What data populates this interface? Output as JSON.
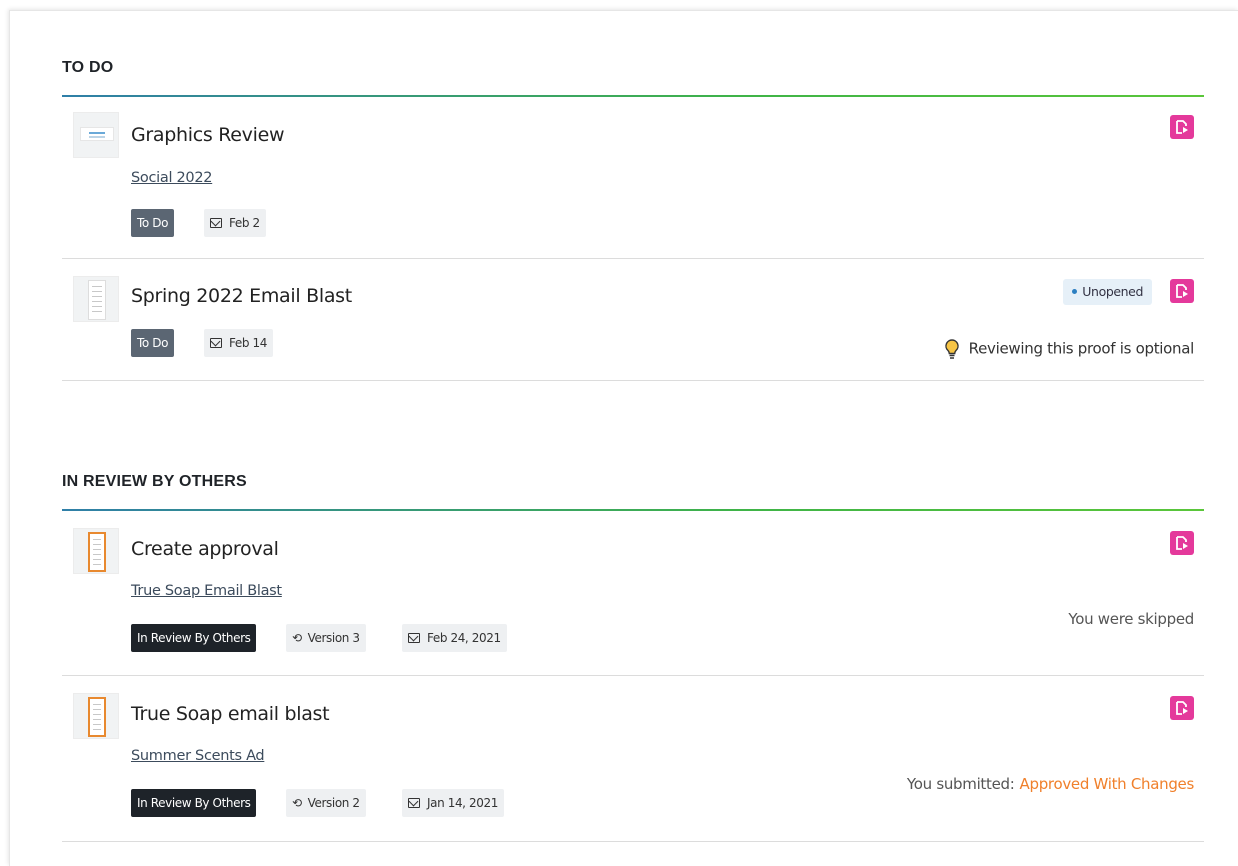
{
  "colors": {
    "edit": "#e4399b",
    "todo_tag": "#5b6673",
    "review_tag": "#1e2329",
    "accent": "#f0802b",
    "rule_start": "#2f7fa8",
    "rule_end": "#5ac63a"
  },
  "sections": [
    {
      "title": "TO DO",
      "rows": [
        {
          "title": "Graphics Review",
          "link": "Social 2022",
          "status": "To Do",
          "date": "Feb 2",
          "thumb_icon": "web-banner-thumbnail"
        },
        {
          "title": "Spring 2022 Email Blast",
          "status": "To Do",
          "date": "Feb 14",
          "badge": "Unopened",
          "note": "Reviewing this proof is optional",
          "thumb_icon": "document-thumbnail"
        }
      ]
    },
    {
      "title": "IN REVIEW BY OTHERS",
      "rows": [
        {
          "title": "Create approval",
          "link": "True Soap Email Blast",
          "status": "In Review By Others",
          "version": "Version 3",
          "date": "Feb 24, 2021",
          "note": "You were skipped",
          "thumb_icon": "document-thumbnail"
        },
        {
          "title": "True Soap email blast",
          "link": "Summer Scents Ad",
          "status": "In Review By Others",
          "version": "Version 2",
          "date": "Jan 14, 2021",
          "note_label": "You submitted:",
          "note_value": "Approved With Changes",
          "thumb_icon": "document-thumbnail"
        }
      ]
    }
  ]
}
